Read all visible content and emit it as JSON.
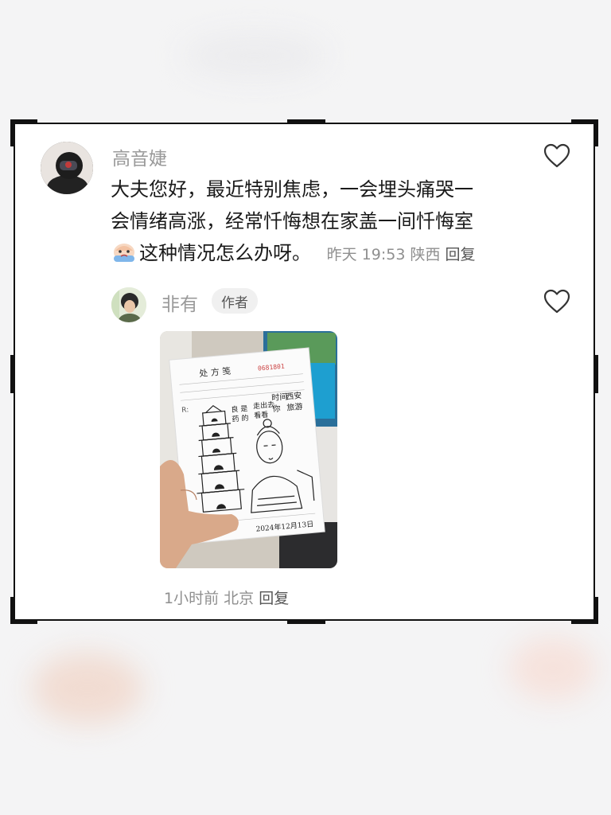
{
  "comment": {
    "author": "高音婕",
    "lines": [
      "大夫您好，最近特别焦虑，一会埋头痛哭一",
      "会情绪高涨，经常忏悔想在家盖一间忏悔室",
      "这种情况怎么办呀。"
    ],
    "time": "昨天 19:53",
    "location": "陕西",
    "reply_label": "回复",
    "emoji_icon": "crying-face-emoji"
  },
  "reply": {
    "author": "非有",
    "badge": "作者",
    "prescription_photo": {
      "form_title": "处 方 笺",
      "serial": "0681801",
      "handwritten_text": [
        "西安",
        "旅游",
        "时间",
        "你",
        "走出去",
        "看看",
        "是",
        "的",
        "良",
        "药"
      ],
      "date": "2024年12月13日"
    },
    "time": "1小时前",
    "location": "北京",
    "reply_label": "回复"
  },
  "colors": {
    "frame": "#111111",
    "meta": "#8f8f8f",
    "text": "#1a1a1a"
  }
}
